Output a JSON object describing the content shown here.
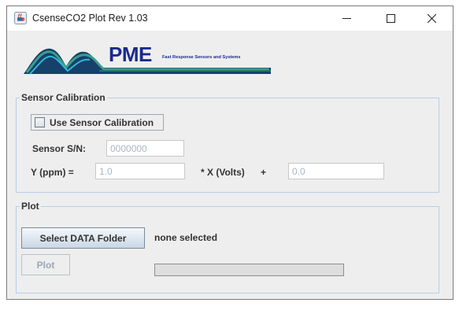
{
  "window": {
    "title": "CsenseCO2 Plot Rev 1.03",
    "controls": [
      "minimize-icon",
      "maximize-icon",
      "close-icon"
    ]
  },
  "logo": {
    "brand": "PME",
    "tagline": "Fast Response Sensors and Systems",
    "brand_color": "#1a2a8c"
  },
  "calibration": {
    "legend": "Sensor Calibration",
    "use_calibration": {
      "label": "Use Sensor Calibration",
      "checked": false
    },
    "serial": {
      "label": "Sensor S/N:",
      "value": "0000000"
    },
    "formula": {
      "y_label": "Y (ppm) =",
      "slope_value": "1.0",
      "x_label": "* X (Volts)",
      "plus": "+",
      "offset_value": "0.0"
    }
  },
  "plot": {
    "legend": "Plot",
    "select_folder_label": "Select DATA Folder",
    "folder_status": "none selected",
    "plot_button_label": "Plot",
    "progress": 0
  }
}
